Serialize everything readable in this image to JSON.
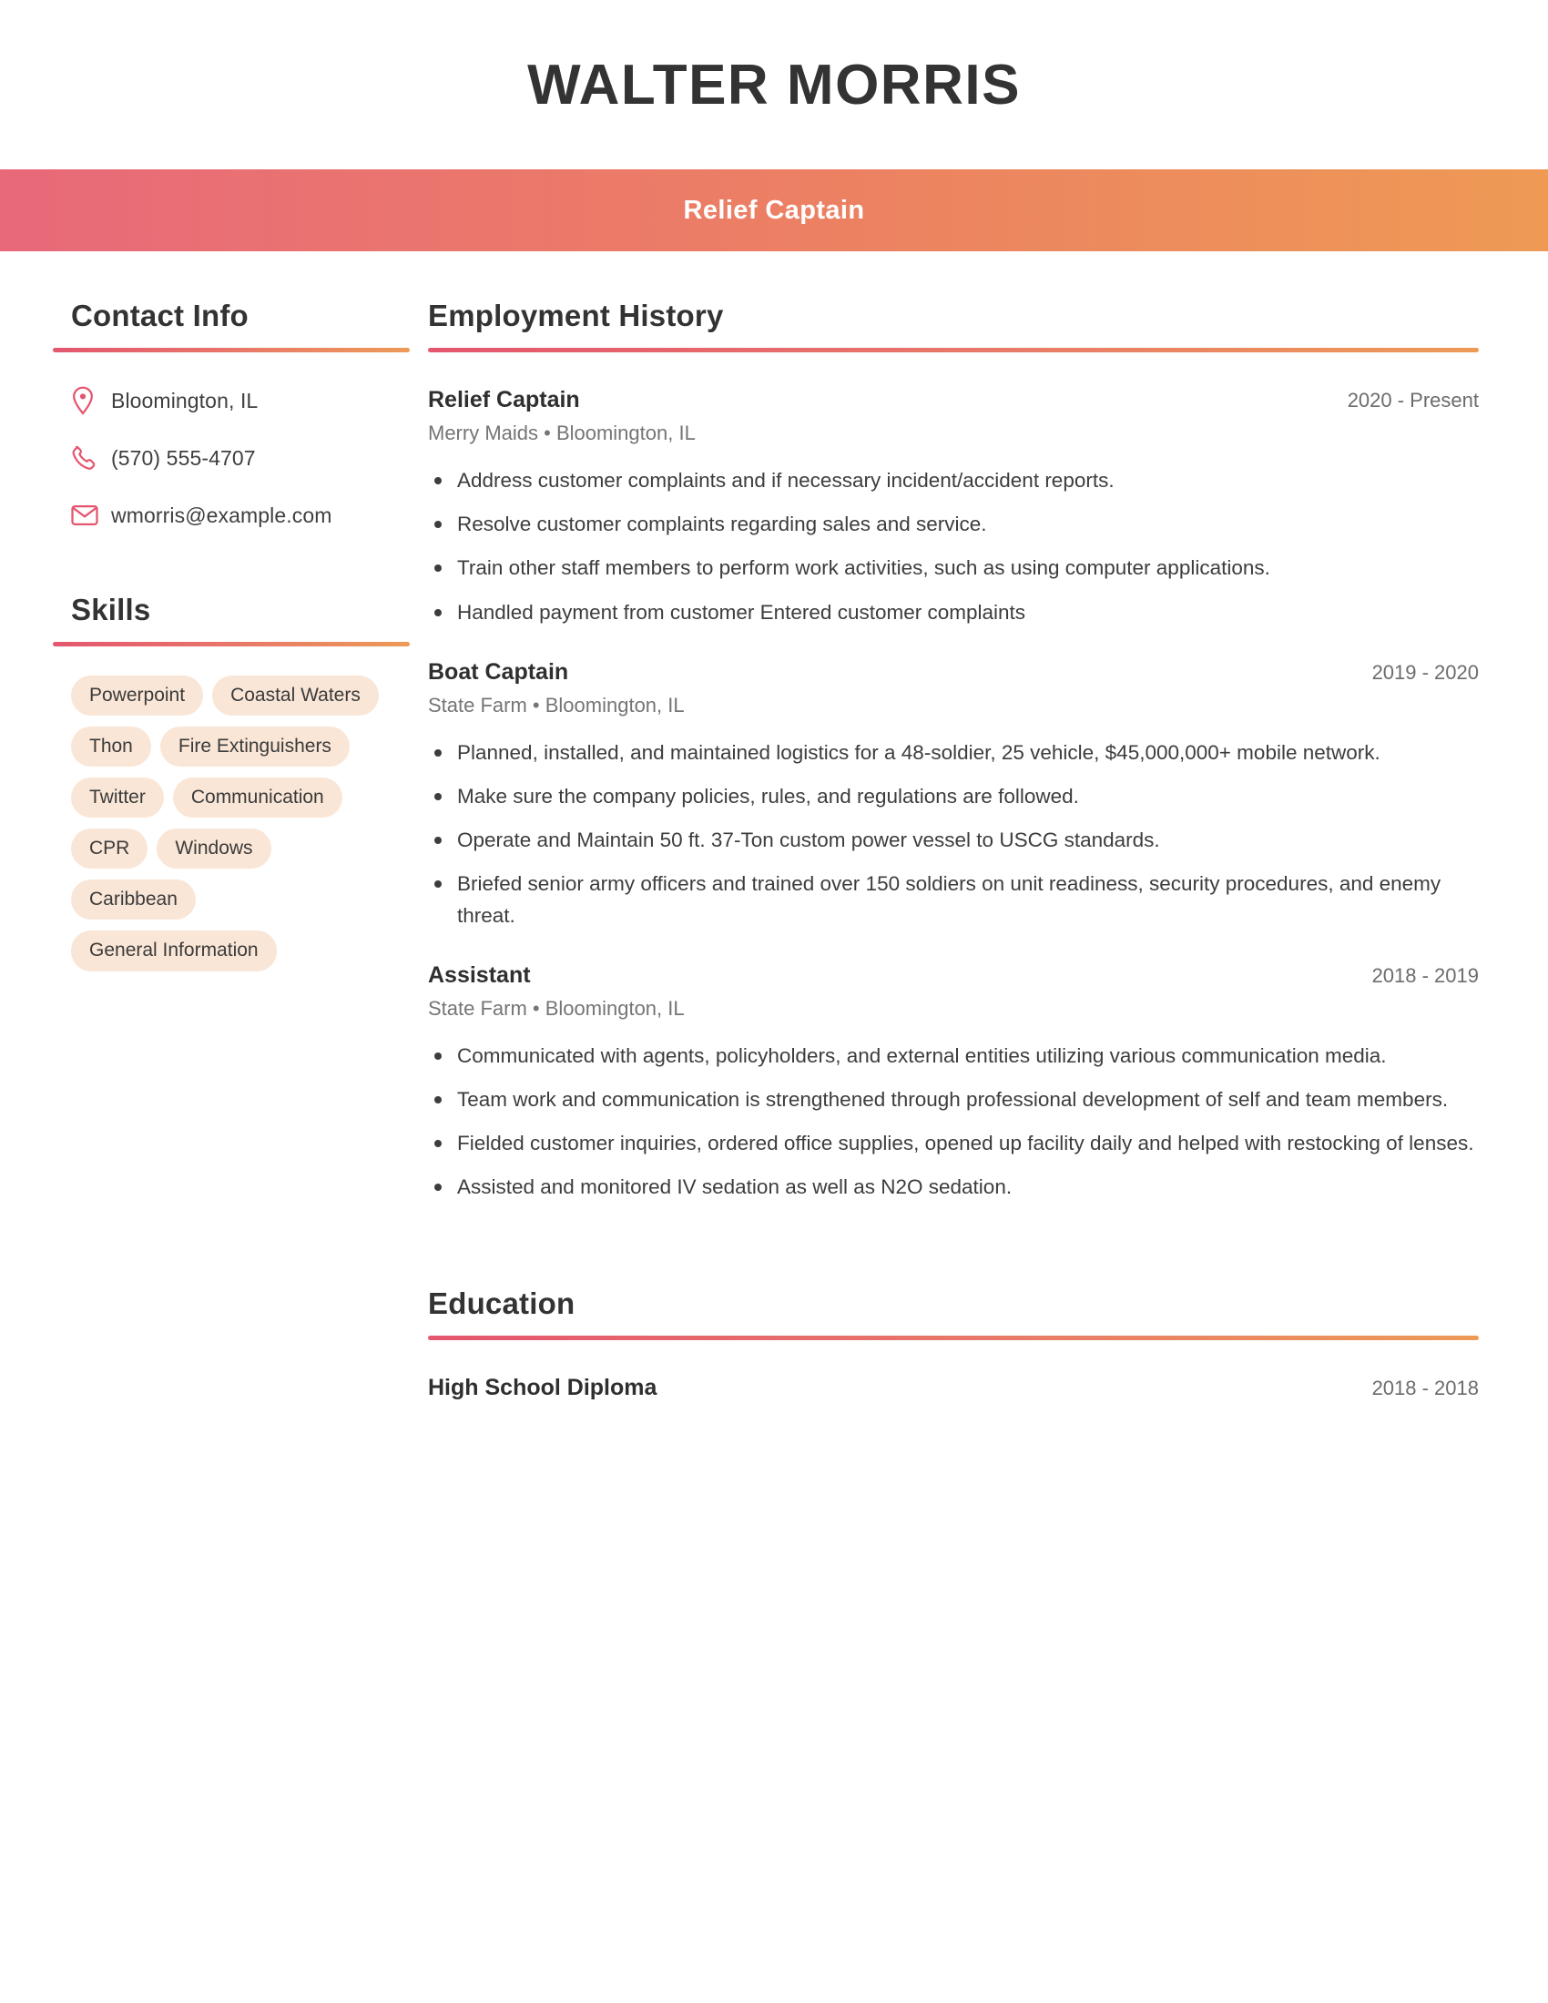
{
  "header": {
    "name": "WALTER MORRIS",
    "job_title": "Relief Captain",
    "gradient_start": "#e8697a",
    "gradient_end": "#ee9a55"
  },
  "sidebar": {
    "contact": {
      "heading": "Contact Info",
      "items": [
        {
          "icon": "location-pin-icon",
          "value": "Bloomington, IL"
        },
        {
          "icon": "phone-icon",
          "value": "(570) 555-4707"
        },
        {
          "icon": "envelope-icon",
          "value": "wmorris@example.com"
        }
      ]
    },
    "skills": {
      "heading": "Skills",
      "tags": [
        "Powerpoint",
        "Coastal Waters",
        "Thon",
        "Fire Extinguishers",
        "Twitter",
        "Communication",
        "CPR",
        "Windows",
        "Caribbean",
        "General Information"
      ],
      "tag_color": "#fae6d6"
    }
  },
  "main": {
    "employment": {
      "heading": "Employment History",
      "jobs": [
        {
          "title": "Relief Captain",
          "dates": "2020 - Present",
          "company": "Merry Maids",
          "location": "Bloomington, IL",
          "meta": "Merry Maids  •  Bloomington, IL",
          "bullets": [
            "Address customer complaints and if necessary incident/accident reports.",
            "Resolve customer complaints regarding sales and service.",
            "Train other staff members to perform work activities, such as using computer applications.",
            "Handled payment from customer Entered customer complaints"
          ]
        },
        {
          "title": "Boat Captain",
          "dates": "2019 - 2020",
          "company": "State Farm",
          "location": "Bloomington, IL",
          "meta": "State Farm  •  Bloomington, IL",
          "bullets": [
            "Planned, installed, and maintained logistics for a 48-soldier, 25 vehicle, $45,000,000+ mobile network.",
            "Make sure the company policies, rules, and regulations are followed.",
            "Operate and Maintain 50 ft. 37-Ton custom power vessel to USCG standards.",
            "Briefed senior army officers and trained over 150 soldiers on unit readiness, security procedures, and enemy threat."
          ]
        },
        {
          "title": "Assistant",
          "dates": "2018 - 2019",
          "company": "State Farm",
          "location": "Bloomington, IL",
          "meta": "State Farm  •  Bloomington, IL",
          "bullets": [
            "Communicated with agents, policyholders, and external entities utilizing various communication media.",
            "Team work and communication is strengthened through professional development of self and team members.",
            "Fielded customer inquiries, ordered office supplies, opened up facility daily and helped with restocking of lenses.",
            "Assisted and monitored IV sedation as well as N2O sedation."
          ]
        }
      ]
    },
    "education": {
      "heading": "Education",
      "entries": [
        {
          "degree": "High School Diploma",
          "dates": "2018 - 2018"
        }
      ]
    }
  }
}
